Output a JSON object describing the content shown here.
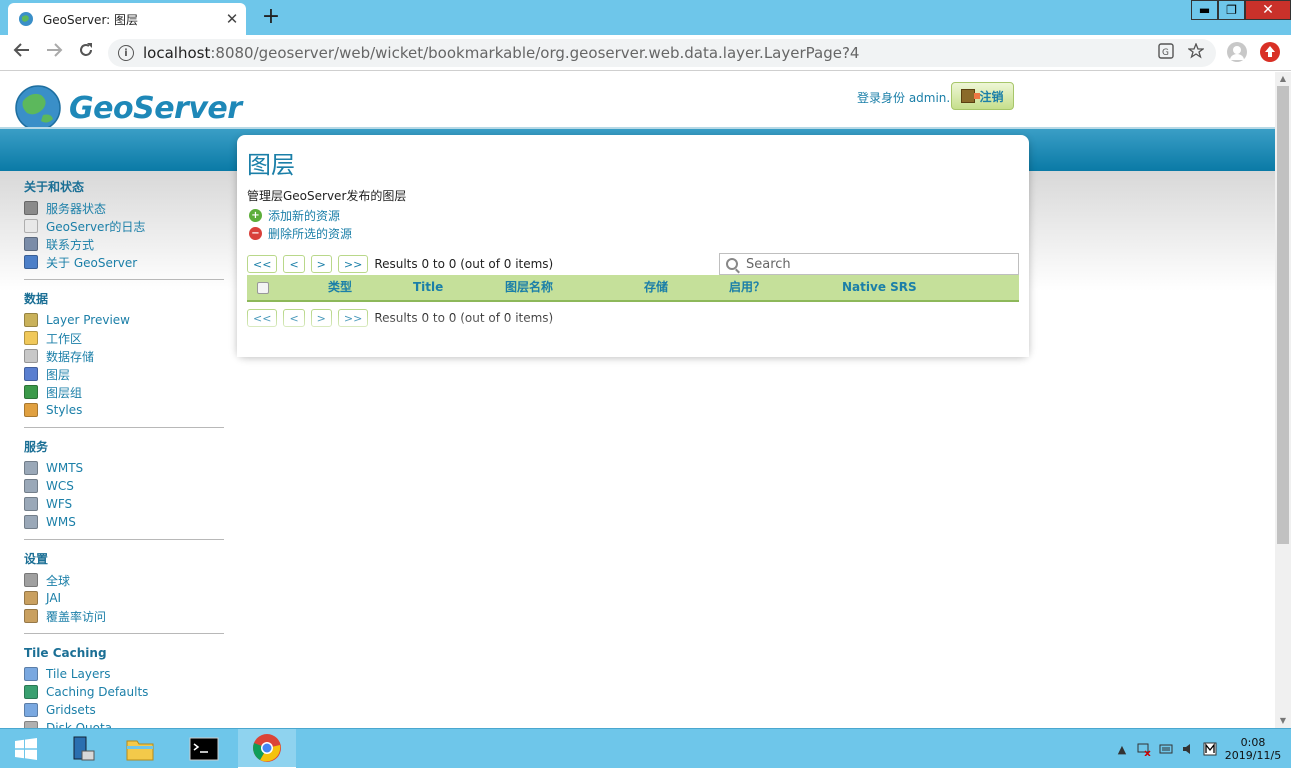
{
  "browser": {
    "tab_title": "GeoServer: 图层",
    "tab_close": "✕",
    "new_tab": "+",
    "url_host": "localhost",
    "url_rest": ":8080/geoserver/web/wicket/bookmarkable/org.geoserver.web.data.layer.LayerPage?4",
    "info_icon": "i",
    "window_controls": {
      "minimize": "▬",
      "restore": "❐",
      "close": "✕"
    }
  },
  "header": {
    "brand": "GeoServer",
    "login_label": "登录身份 admin.",
    "logout_label": "注销"
  },
  "sidebar": {
    "sections": [
      {
        "title": "关于和状态",
        "items": [
          {
            "label": "服务器状态",
            "icon": "server-status-icon",
            "color": "#8a8a8a"
          },
          {
            "label": "GeoServer的日志",
            "icon": "log-icon",
            "color": "#e8e8e8"
          },
          {
            "label": "联系方式",
            "icon": "contact-icon",
            "color": "#7a8ca8"
          },
          {
            "label": "关于 GeoServer",
            "icon": "about-icon",
            "color": "#4c7fc8"
          }
        ]
      },
      {
        "title": "数据",
        "items": [
          {
            "label": "Layer Preview",
            "icon": "layer-preview-icon",
            "color": "#c9b15a"
          },
          {
            "label": "工作区",
            "icon": "workspace-icon",
            "color": "#f0c85a"
          },
          {
            "label": "数据存储",
            "icon": "datastore-icon",
            "color": "#c8c8c8"
          },
          {
            "label": "图层",
            "icon": "layer-icon",
            "color": "#5a7fd0"
          },
          {
            "label": "图层组",
            "icon": "layer-group-icon",
            "color": "#3c9a4a"
          },
          {
            "label": "Styles",
            "icon": "styles-icon",
            "color": "#e0a040"
          }
        ]
      },
      {
        "title": "服务",
        "items": [
          {
            "label": "WMTS",
            "icon": "wmts-icon",
            "color": "#9aa8b8"
          },
          {
            "label": "WCS",
            "icon": "wcs-icon",
            "color": "#9aa8b8"
          },
          {
            "label": "WFS",
            "icon": "wfs-icon",
            "color": "#9aa8b8"
          },
          {
            "label": "WMS",
            "icon": "wms-icon",
            "color": "#9aa8b8"
          }
        ]
      },
      {
        "title": "设置",
        "items": [
          {
            "label": "全球",
            "icon": "global-settings-icon",
            "color": "#a0a0a0"
          },
          {
            "label": "JAI",
            "icon": "jai-icon",
            "color": "#c9a060"
          },
          {
            "label": "覆盖率访问",
            "icon": "coverage-access-icon",
            "color": "#c9a060"
          }
        ]
      },
      {
        "title": "Tile Caching",
        "items": [
          {
            "label": "Tile Layers",
            "icon": "tile-layers-icon",
            "color": "#7aa8e0"
          },
          {
            "label": "Caching Defaults",
            "icon": "caching-defaults-icon",
            "color": "#3aa070"
          },
          {
            "label": "Gridsets",
            "icon": "gridsets-icon",
            "color": "#7aa8e0"
          },
          {
            "label": "Disk Quota",
            "icon": "disk-quota-icon",
            "color": "#b0b0b0"
          }
        ]
      }
    ]
  },
  "main": {
    "title": "图层",
    "description": "管理层GeoServer发布的图层",
    "add_label": "添加新的资源",
    "remove_label": "删除所选的资源",
    "add_glyph": "+",
    "remove_glyph": "−",
    "pager": {
      "first": "<<",
      "prev": "<",
      "next": ">",
      "last": ">>",
      "info": "Results 0 to 0 (out of 0 items)"
    },
    "search_placeholder": "Search",
    "columns": [
      "类型",
      "Title",
      "图层名称",
      "存储",
      "启用？",
      "Native SRS"
    ]
  },
  "taskbar": {
    "time": "0:08",
    "date": "2019/11/5"
  },
  "colors": {
    "accent": "#1b7fa8",
    "band": "#0a7aa6",
    "grid_header": "#c5e09a",
    "add_icon": "#5cae3a",
    "remove_icon": "#d9403a"
  }
}
